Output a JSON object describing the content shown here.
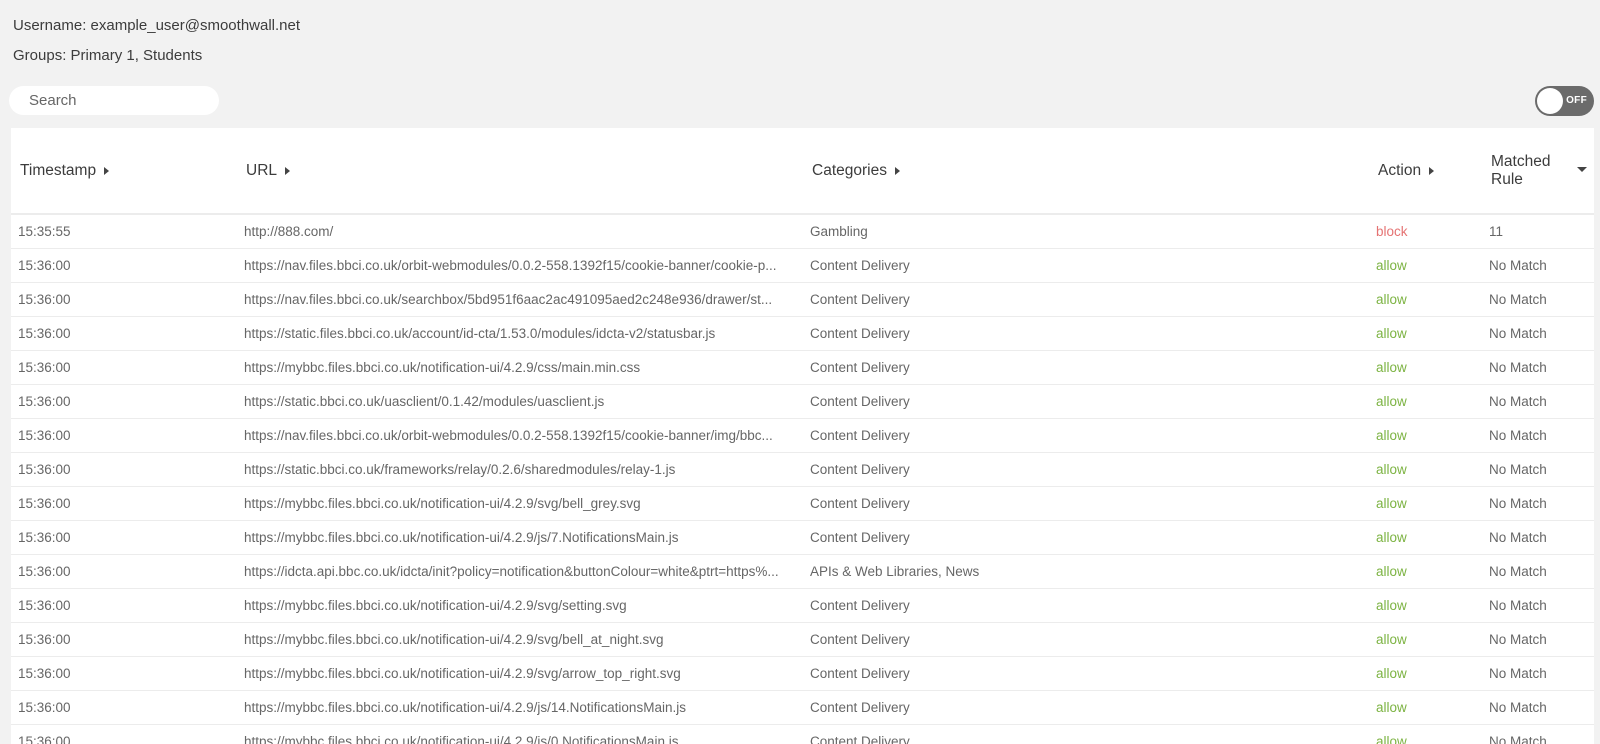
{
  "user": {
    "username_label": "Username: example_user@smoothwall.net",
    "groups_label": "Groups: Primary 1, Students"
  },
  "search": {
    "placeholder": "Search",
    "value": ""
  },
  "toggle": {
    "label": "OFF",
    "state": "off"
  },
  "colors": {
    "block": "#e57373",
    "allow": "#7cb342"
  },
  "table": {
    "headers": {
      "timestamp": "Timestamp",
      "url": "URL",
      "categories": "Categories",
      "action": "Action",
      "matched_rule": "Matched Rule"
    },
    "rows": [
      {
        "timestamp": "15:35:55",
        "url": "http://888.com/",
        "categories": "Gambling",
        "action": "block",
        "matched_rule": "11"
      },
      {
        "timestamp": "15:36:00",
        "url": "https://nav.files.bbci.co.uk/orbit-webmodules/0.0.2-558.1392f15/cookie-banner/cookie-p...",
        "categories": "Content Delivery",
        "action": "allow",
        "matched_rule": "No Match"
      },
      {
        "timestamp": "15:36:00",
        "url": "https://nav.files.bbci.co.uk/searchbox/5bd951f6aac2ac491095aed2c248e936/drawer/st...",
        "categories": "Content Delivery",
        "action": "allow",
        "matched_rule": "No Match"
      },
      {
        "timestamp": "15:36:00",
        "url": "https://static.files.bbci.co.uk/account/id-cta/1.53.0/modules/idcta-v2/statusbar.js",
        "categories": "Content Delivery",
        "action": "allow",
        "matched_rule": "No Match"
      },
      {
        "timestamp": "15:36:00",
        "url": "https://mybbc.files.bbci.co.uk/notification-ui/4.2.9/css/main.min.css",
        "categories": "Content Delivery",
        "action": "allow",
        "matched_rule": "No Match"
      },
      {
        "timestamp": "15:36:00",
        "url": "https://static.bbci.co.uk/uasclient/0.1.42/modules/uasclient.js",
        "categories": "Content Delivery",
        "action": "allow",
        "matched_rule": "No Match"
      },
      {
        "timestamp": "15:36:00",
        "url": "https://nav.files.bbci.co.uk/orbit-webmodules/0.0.2-558.1392f15/cookie-banner/img/bbc...",
        "categories": "Content Delivery",
        "action": "allow",
        "matched_rule": "No Match"
      },
      {
        "timestamp": "15:36:00",
        "url": "https://static.bbci.co.uk/frameworks/relay/0.2.6/sharedmodules/relay-1.js",
        "categories": "Content Delivery",
        "action": "allow",
        "matched_rule": "No Match"
      },
      {
        "timestamp": "15:36:00",
        "url": "https://mybbc.files.bbci.co.uk/notification-ui/4.2.9/svg/bell_grey.svg",
        "categories": "Content Delivery",
        "action": "allow",
        "matched_rule": "No Match"
      },
      {
        "timestamp": "15:36:00",
        "url": "https://mybbc.files.bbci.co.uk/notification-ui/4.2.9/js/7.NotificationsMain.js",
        "categories": "Content Delivery",
        "action": "allow",
        "matched_rule": "No Match"
      },
      {
        "timestamp": "15:36:00",
        "url": "https://idcta.api.bbc.co.uk/idcta/init?policy=notification&buttonColour=white&ptrt=https%...",
        "categories": "APIs & Web Libraries, News",
        "action": "allow",
        "matched_rule": "No Match"
      },
      {
        "timestamp": "15:36:00",
        "url": "https://mybbc.files.bbci.co.uk/notification-ui/4.2.9/svg/setting.svg",
        "categories": "Content Delivery",
        "action": "allow",
        "matched_rule": "No Match"
      },
      {
        "timestamp": "15:36:00",
        "url": "https://mybbc.files.bbci.co.uk/notification-ui/4.2.9/svg/bell_at_night.svg",
        "categories": "Content Delivery",
        "action": "allow",
        "matched_rule": "No Match"
      },
      {
        "timestamp": "15:36:00",
        "url": "https://mybbc.files.bbci.co.uk/notification-ui/4.2.9/svg/arrow_top_right.svg",
        "categories": "Content Delivery",
        "action": "allow",
        "matched_rule": "No Match"
      },
      {
        "timestamp": "15:36:00",
        "url": "https://mybbc.files.bbci.co.uk/notification-ui/4.2.9/js/14.NotificationsMain.js",
        "categories": "Content Delivery",
        "action": "allow",
        "matched_rule": "No Match"
      },
      {
        "timestamp": "15:36:00",
        "url": "https://mybbc.files.bbci.co.uk/notification-ui/4.2.9/js/0.NotificationsMain.js",
        "categories": "Content Delivery",
        "action": "allow",
        "matched_rule": "No Match"
      }
    ]
  }
}
